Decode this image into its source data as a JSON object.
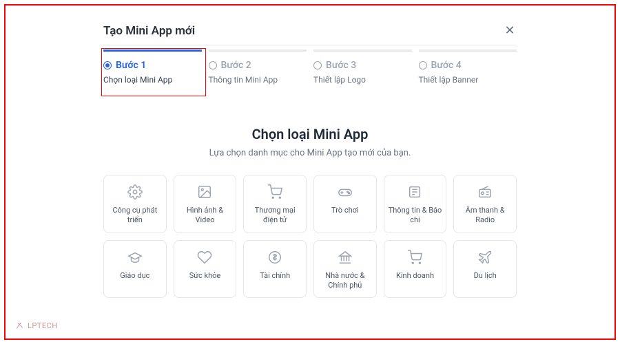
{
  "header": {
    "title": "Tạo Mini App mới",
    "close": "✕"
  },
  "steps": [
    {
      "label": "Bước 1",
      "sub": "Chọn loại Mini App",
      "active": true
    },
    {
      "label": "Bước 2",
      "sub": "Thông tin Mini App",
      "active": false
    },
    {
      "label": "Bước 3",
      "sub": "Thiết lập Logo",
      "active": false
    },
    {
      "label": "Bước 4",
      "sub": "Thiết lập Banner",
      "active": false
    }
  ],
  "section": {
    "heading": "Chọn loại Mini App",
    "sub": "Lựa chọn danh mục cho Mini App tạo mới của bạn."
  },
  "categories": [
    {
      "icon": "gear-icon",
      "label": "Công cụ phát triển"
    },
    {
      "icon": "image-icon",
      "label": "Hình ảnh & Video"
    },
    {
      "icon": "cart-icon",
      "label": "Thương mại điện tử"
    },
    {
      "icon": "gamepad-icon",
      "label": "Trò chơi"
    },
    {
      "icon": "news-icon",
      "label": "Thông tin & Báo chí"
    },
    {
      "icon": "radio-icon",
      "label": "Âm thanh & Radio"
    },
    {
      "icon": "graduation-icon",
      "label": "Giáo dục"
    },
    {
      "icon": "heart-icon",
      "label": "Sức khỏe"
    },
    {
      "icon": "dollar-icon",
      "label": "Tài chính"
    },
    {
      "icon": "bank-icon",
      "label": "Nhà nước & Chính phủ"
    },
    {
      "icon": "shop-cart-icon",
      "label": "Kinh doanh"
    },
    {
      "icon": "plane-icon",
      "label": "Du lịch"
    }
  ],
  "watermark": {
    "text": "LPTECH"
  }
}
